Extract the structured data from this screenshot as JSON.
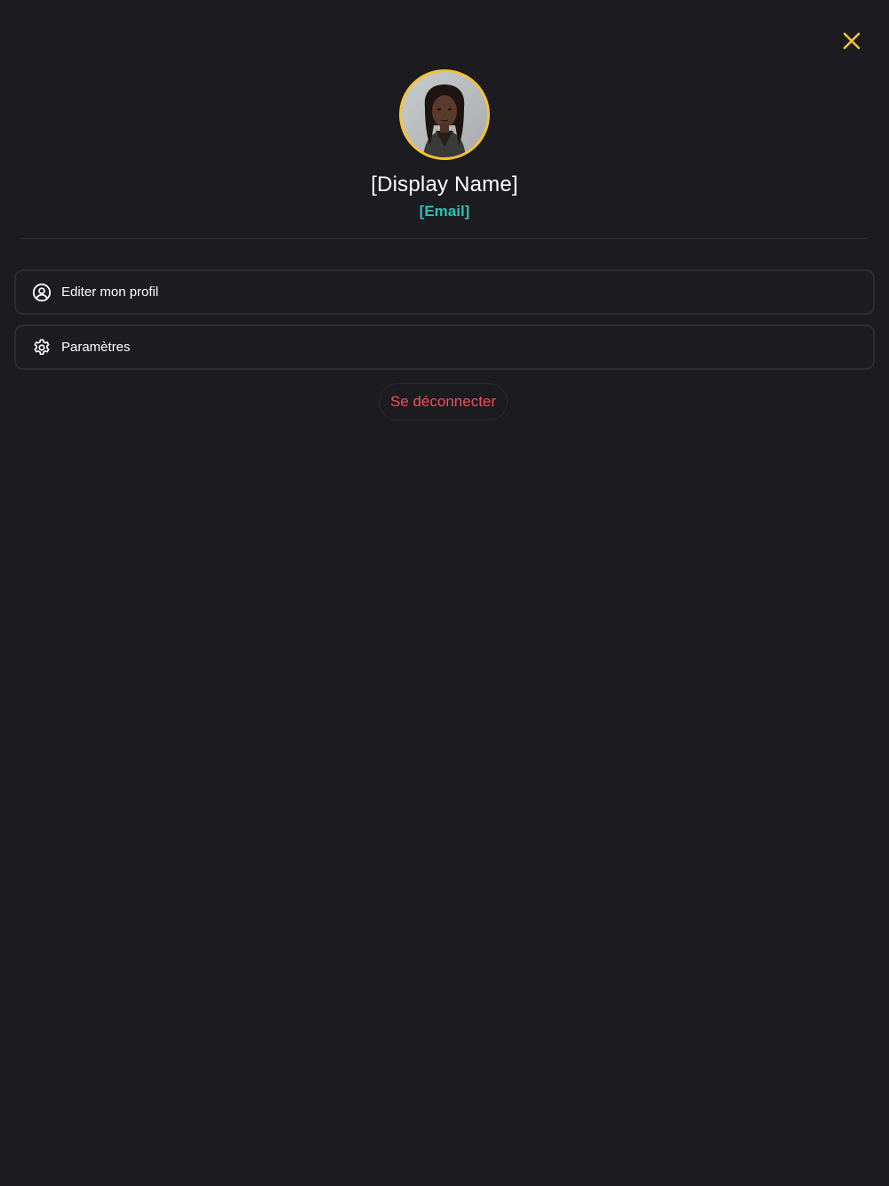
{
  "header": {
    "close_icon": "close-icon",
    "close_color": "#f5c431"
  },
  "profile": {
    "display_name": "[Display Name]",
    "email": "[Email]",
    "avatar_border_color": "#f5c431",
    "email_color": "#2cc2b3"
  },
  "menu": {
    "items": [
      {
        "icon": "user-circle-icon",
        "label": "Editer mon profil"
      },
      {
        "icon": "gear-icon",
        "label": "Paramètres"
      }
    ]
  },
  "logout": {
    "label": "Se déconnecter",
    "color": "#ef4f5a"
  }
}
